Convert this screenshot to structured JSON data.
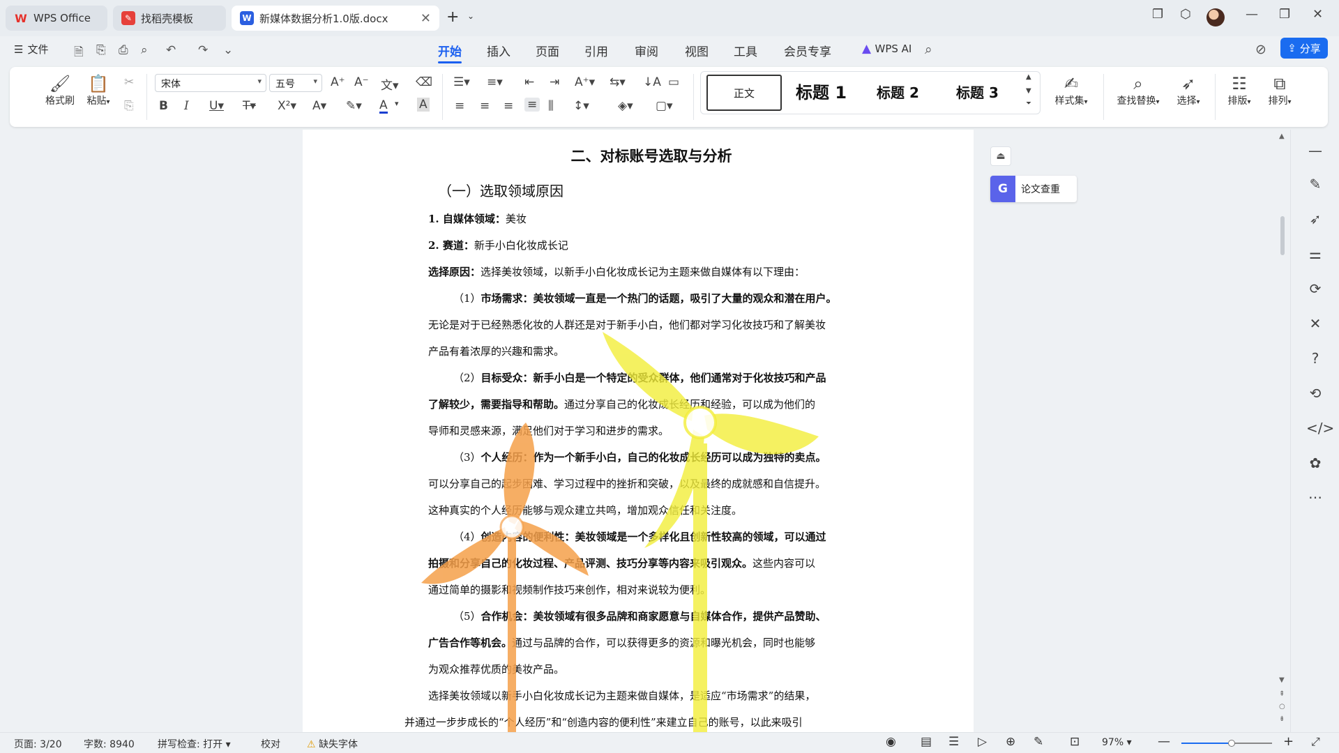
{
  "tabs": [
    {
      "label": "WPS Office"
    },
    {
      "label": "找稻壳模板"
    },
    {
      "label": "新媒体数据分析1.0版.docx"
    }
  ],
  "menu": {
    "file_label": "文件",
    "tabs": [
      "开始",
      "插入",
      "页面",
      "引用",
      "审阅",
      "视图",
      "工具",
      "会员专享"
    ],
    "active_tab": "开始",
    "ai_label": "WPS AI",
    "share_label": "分享"
  },
  "ribbon": {
    "format_painter": "格式刷",
    "paste": "粘贴",
    "font_name": "宋体",
    "font_size": "五号",
    "style_normal": "正文",
    "style_h1": "标题 1",
    "style_h2": "标题 2",
    "style_h3": "标题 3",
    "style_set": "样式集",
    "find_replace": "查找替换",
    "select": "选择",
    "layout": "排版",
    "arrange": "排列"
  },
  "document": {
    "heading2": "二、对标账号选取与分析",
    "heading3": "（一）选取领域原因",
    "lines": [
      {
        "b": "1. 自媒体领域：",
        "t": "美妆"
      },
      {
        "b": "2. 赛道：",
        "t": "新手小白化妆成长记"
      },
      {
        "b": "选择原因：",
        "t": "选择美妆领域，以新手小白化妆成长记为主题来做自媒体有以下理由："
      },
      {
        "b": "",
        "t": "（1）",
        "b2": "市场需求：美妆领域一直是一个热门的话题，吸引了大量的观众和潜在用户。"
      },
      {
        "b": "",
        "t": "无论是对于已经熟悉化妆的人群还是对于新手小白，他们都对学习化妆技巧和了解美妆"
      },
      {
        "b": "",
        "t": "产品有着浓厚的兴趣和需求。"
      },
      {
        "b": "",
        "t": "（2）",
        "b2": "目标受众：新手小白是一个特定的受众群体，他们通常对于化妆技巧和产品"
      },
      {
        "b": "了解较少，需要指导和帮助。",
        "t": "通过分享自己的化妆成长经历和经验，可以成为他们的"
      },
      {
        "b": "",
        "t": "导师和灵感来源，满足他们对于学习和进步的需求。"
      },
      {
        "b": "",
        "t": "（3）",
        "b2": "个人经历：作为一个新手小白，自己的化妆成长经历可以成为独特的卖点。"
      },
      {
        "b": "",
        "t": "可以分享自己的起步困难、学习过程中的挫折和突破，以及最终的成就感和自信提升。"
      },
      {
        "b": "",
        "t": "这种真实的个人经历能够与观众建立共鸣，增加观众信任和关注度。"
      },
      {
        "b": "",
        "t": "（4）",
        "b2": "创造内容的便利性：美妆领域是一个多样化且创新性较高的领域，可以通过"
      },
      {
        "b": "拍摄和分享自己的化妆过程、产品评测、技巧分享等内容来吸引观众。",
        "t": "这些内容可以"
      },
      {
        "b": "",
        "t": "通过简单的摄影和视频制作技巧来创作，相对来说较为便利。"
      },
      {
        "b": "",
        "t": "（5）",
        "b2": "合作机会：美妆领域有很多品牌和商家愿意与自媒体合作，提供产品赞助、"
      },
      {
        "b": "广告合作等机会。",
        "t": "通过与品牌的合作，可以获得更多的资源和曝光机会，同时也能够"
      },
      {
        "b": "",
        "t": "为观众推荐优质的美妆产品。"
      },
      {
        "b": "",
        "t": "选择美妆领域以新手小白化妆成长记为主题来做自媒体，是适应“市场需求”的结果，"
      },
      {
        "b": "",
        "t": "并通过一步步成长的“个人经历”和“创造内容的便利性”来建立自己的账号，以此来吸引"
      }
    ]
  },
  "panel": {
    "plagiarism_check": "论文查重"
  },
  "status": {
    "page": "页面: 3/20",
    "words": "字数: 8940",
    "spell": "拼写检查: 打开",
    "proof": "校对",
    "missing_font": "缺失字体",
    "zoom": "97%",
    "zoom_level": 0.55
  },
  "colors": {
    "accent": "#1a5ff0",
    "pinwheel_orange": "#f5a04a",
    "pinwheel_yellow": "#f2ee3a"
  }
}
